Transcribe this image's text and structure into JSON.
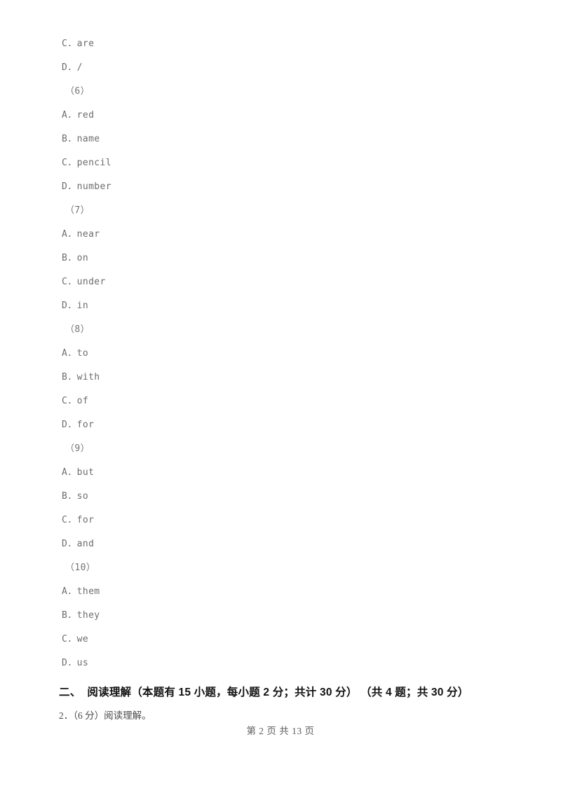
{
  "document": {
    "type": "scanned-exam-paper",
    "page_background": "#ffffff",
    "body_text_color": "#6d6d6d",
    "heading_text_color": "#111111"
  },
  "lines": [
    {
      "kind": "option",
      "text": "C．are"
    },
    {
      "kind": "option",
      "text": "D．/"
    },
    {
      "kind": "qnum",
      "text": "（6）"
    },
    {
      "kind": "option",
      "text": "A．red"
    },
    {
      "kind": "option",
      "text": "B．name"
    },
    {
      "kind": "option",
      "text": "C．pencil"
    },
    {
      "kind": "option",
      "text": "D．number"
    },
    {
      "kind": "qnum",
      "text": "（7）"
    },
    {
      "kind": "option",
      "text": "A．near"
    },
    {
      "kind": "option",
      "text": "B．on"
    },
    {
      "kind": "option",
      "text": "C．under"
    },
    {
      "kind": "option",
      "text": "D．in"
    },
    {
      "kind": "qnum",
      "text": "（8）"
    },
    {
      "kind": "option",
      "text": "A．to"
    },
    {
      "kind": "option",
      "text": "B．with"
    },
    {
      "kind": "option",
      "text": "C．of"
    },
    {
      "kind": "option",
      "text": "D．for"
    },
    {
      "kind": "qnum",
      "text": "（9）"
    },
    {
      "kind": "option",
      "text": "A．but"
    },
    {
      "kind": "option",
      "text": "B．so"
    },
    {
      "kind": "option",
      "text": "C．for"
    },
    {
      "kind": "option",
      "text": "D．and"
    },
    {
      "kind": "qnum",
      "text": "（10）"
    },
    {
      "kind": "option",
      "text": "A．them"
    },
    {
      "kind": "option",
      "text": "B．they"
    },
    {
      "kind": "option",
      "text": "C．we"
    },
    {
      "kind": "option",
      "text": "D．us"
    }
  ],
  "section": {
    "heading": "二、  阅读理解（本题有 15 小题，每小题 2 分；共计 30 分） （共 4 题；共 30 分）"
  },
  "subquestion": {
    "text": "2．（6 分）阅读理解。"
  },
  "footer": {
    "text": "第 2 页 共 13 页"
  }
}
